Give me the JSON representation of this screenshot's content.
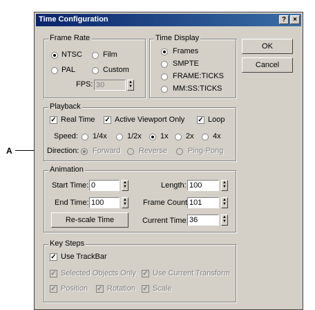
{
  "window": {
    "title": "Time Configuration",
    "help_label": "?",
    "close_label": "×"
  },
  "annotation": {
    "label": "A"
  },
  "frame_rate": {
    "legend": "Frame Rate",
    "options": [
      "NTSC",
      "Film",
      "PAL",
      "Custom"
    ],
    "selected": "NTSC",
    "fps_label": "FPS:",
    "fps_value": "30"
  },
  "time_display": {
    "legend": "Time Display",
    "options": [
      "Frames",
      "SMPTE",
      "FRAME:TICKS",
      "MM:SS:TICKS"
    ],
    "selected": "Frames"
  },
  "buttons": {
    "ok": "OK",
    "cancel": "Cancel"
  },
  "playback": {
    "legend": "Playback",
    "real_time": "Real Time",
    "active_viewport": "Active Viewport Only",
    "loop": "Loop",
    "speed_label": "Speed:",
    "speeds": [
      "1/4x",
      "1/2x",
      "1x",
      "2x",
      "4x"
    ],
    "speed_selected": "1x",
    "direction_label": "Direction:",
    "directions": [
      "Forward",
      "Reverse",
      "Ping-Pong"
    ],
    "direction_selected": "Forward"
  },
  "animation": {
    "legend": "Animation",
    "start_time_label": "Start Time:",
    "start_time": "0",
    "length_label": "Length:",
    "length": "100",
    "end_time_label": "End Time:",
    "end_time": "100",
    "frame_count_label": "Frame Count:",
    "frame_count": "101",
    "rescale_button": "Re-scale Time",
    "current_time_label": "Current Time:",
    "current_time": "36"
  },
  "key_steps": {
    "legend": "Key Steps",
    "use_trackbar": "Use TrackBar",
    "selected_objects_only": "Selected Objects Only",
    "use_current_transform": "Use Current Transform",
    "position": "Position",
    "rotation": "Rotation",
    "scale": "Scale"
  }
}
